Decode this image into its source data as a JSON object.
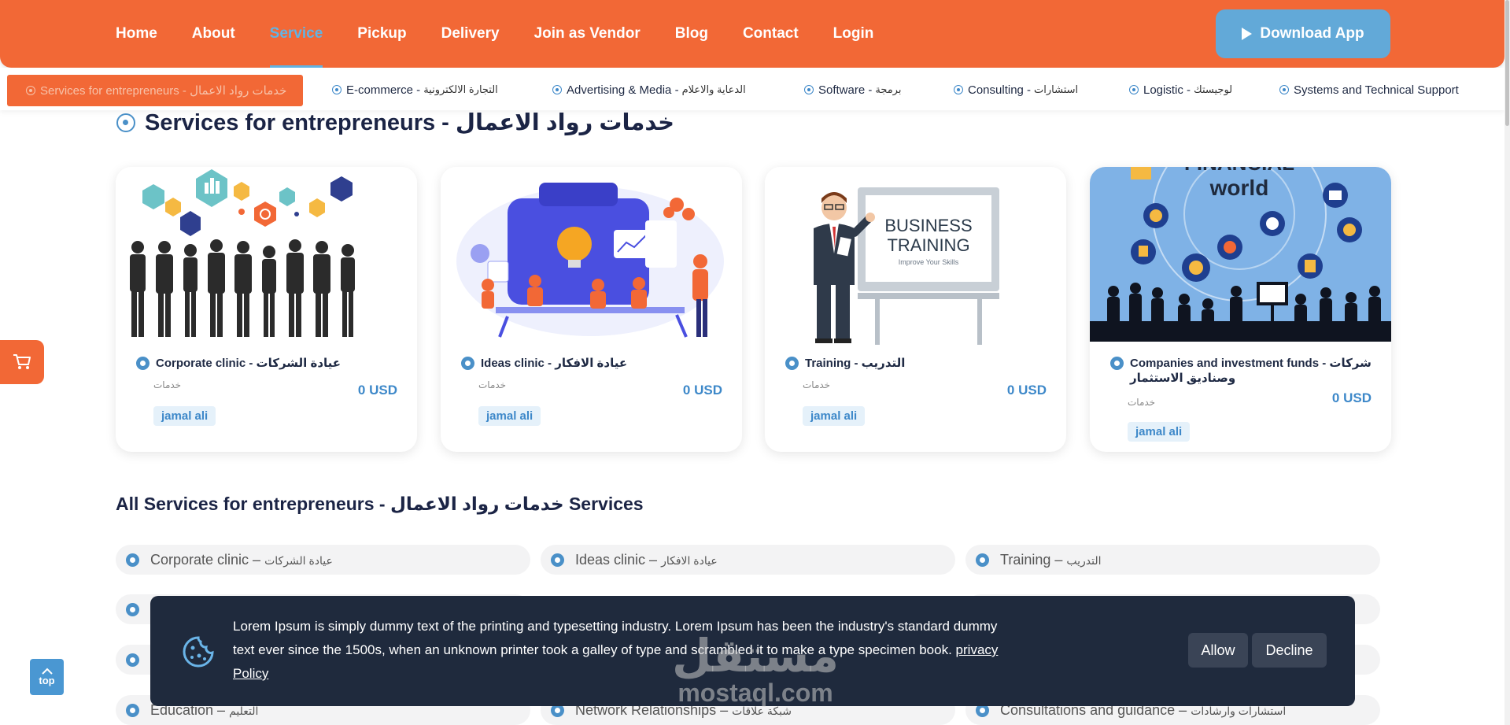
{
  "nav": {
    "items": [
      {
        "label": "Home"
      },
      {
        "label": "About"
      },
      {
        "label": "Service",
        "active": true
      },
      {
        "label": "Pickup"
      },
      {
        "label": "Delivery"
      },
      {
        "label": "Join as Vendor"
      },
      {
        "label": "Blog"
      },
      {
        "label": "Contact"
      },
      {
        "label": "Login"
      }
    ],
    "download_label": "Download App"
  },
  "categories": [
    {
      "en": "Services for entrepreneurs - خدمات رواد الاعمال",
      "ar": "",
      "active": true
    },
    {
      "en": "E-commerce - ",
      "ar": "التجارة الالكترونية"
    },
    {
      "en": "Advertising & Media - ",
      "ar": "الدعاية والاعلام"
    },
    {
      "en": "Software - ",
      "ar": "برمجة"
    },
    {
      "en": "Consulting - ",
      "ar": "استشارات"
    },
    {
      "en": "Logistic - ",
      "ar": "لوجيستك"
    },
    {
      "en": "Systems and Technical Support",
      "ar": ""
    }
  ],
  "section_title": "Services for entrepreneurs - خدمات رواد الاعمال",
  "cards": [
    {
      "name": "Corporate clinic - عيادة الشركات",
      "category": "خدمات",
      "price": "0 USD",
      "vendor": "jamal ali"
    },
    {
      "name": "Ideas clinic - عيادة الافكار",
      "category": "خدمات",
      "price": "0 USD",
      "vendor": "jamal ali"
    },
    {
      "name": "Training - التدريب",
      "category": "خدمات",
      "price": "0 USD",
      "vendor": "jamal ali"
    },
    {
      "name": "Companies and investment funds - شركات وصناديق الاستثمار",
      "category": "خدمات",
      "price": "0 USD",
      "vendor": "jamal ali"
    }
  ],
  "card_images": {
    "training_board_line1": "BUSINESS",
    "training_board_line2": "TRAINING",
    "training_board_line3": "Improve Your Skills",
    "finance_title_1": "FINANCIAL",
    "finance_title_2": "world"
  },
  "all_services": {
    "title": "All Services for entrepreneurs - خدمات رواد الاعمال Services",
    "items": [
      {
        "en": "Corporate clinic – ",
        "ar": "عيادة الشركات"
      },
      {
        "en": "Ideas clinic – ",
        "ar": "عيادة الافكار"
      },
      {
        "en": "Training – ",
        "ar": "التدريب"
      },
      {
        "en": "Education – ",
        "ar": "التعليم"
      },
      {
        "en": "Network Relationships – ",
        "ar": "شبكة علاقات"
      },
      {
        "en": "Consultations and guidance – ",
        "ar": "استشارات وارشادات"
      }
    ]
  },
  "cookie": {
    "text": "Lorem Ipsum is simply dummy text of the printing and typesetting industry. Lorem Ipsum has been the industry's standard dummy text ever since the 1500s, when an unknown printer took a galley of type and scrambled it to make a type specimen book.",
    "link": "privacy Policy",
    "allow": "Allow",
    "decline": "Decline"
  },
  "watermark": {
    "ar": "مستقل",
    "en": "mostaql.com"
  },
  "top_button": "top",
  "colors": {
    "brand_orange": "#f26836",
    "accent_blue": "#62a9d8",
    "dark_banner": "#1f2a3d"
  }
}
